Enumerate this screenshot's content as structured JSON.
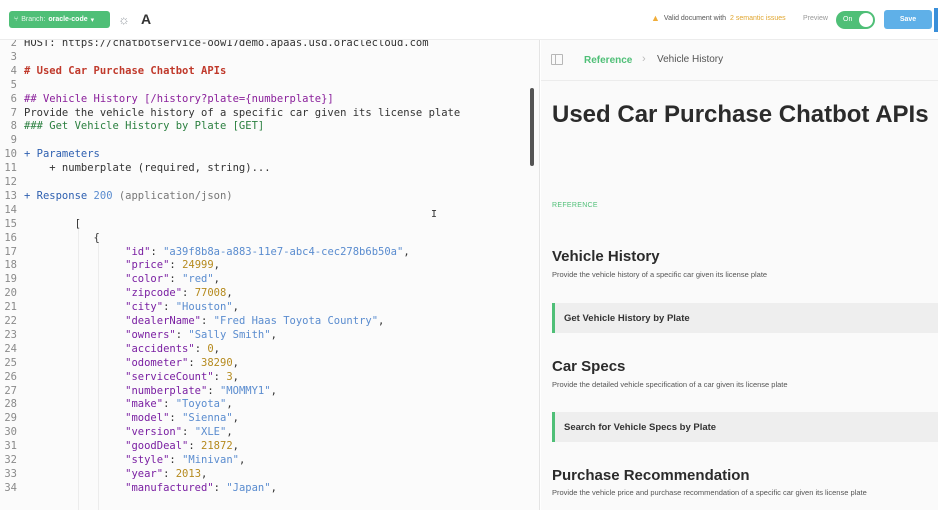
{
  "toolbar": {
    "branch_label": "Branch:",
    "branch_value": "oracle-code",
    "font_icon_label": "A",
    "validity_text": "Valid document with",
    "validity_issues": "2 semantic issues",
    "preview_label": "Preview",
    "toggle_label": "On",
    "save_label": "Save"
  },
  "editor": {
    "lines": [
      {
        "n": "2",
        "tokens": [
          {
            "t": "HOST: https://chatbotservice-oow17demo.apaas.usd.oraclecloud.com",
            "c": "t-plain"
          }
        ]
      },
      {
        "n": "3",
        "tokens": []
      },
      {
        "n": "4",
        "tokens": [
          {
            "t": "# Used Car Purchase Chatbot APIs",
            "c": "t-h"
          }
        ]
      },
      {
        "n": "5",
        "tokens": []
      },
      {
        "n": "6",
        "tokens": [
          {
            "t": "## Vehicle History [/history?plate={numberplate}]",
            "c": "t-h2"
          }
        ]
      },
      {
        "n": "7",
        "tokens": [
          {
            "t": "Provide the vehicle history of a specific car given its license plate",
            "c": "t-plain"
          }
        ]
      },
      {
        "n": "8",
        "tokens": [
          {
            "t": "### Get Vehicle History by Plate [GET]",
            "c": "t-green"
          }
        ]
      },
      {
        "n": "9",
        "tokens": []
      },
      {
        "n": "10",
        "tokens": [
          {
            "t": "+ Parameters",
            "c": "t-blue"
          }
        ]
      },
      {
        "n": "11",
        "tokens": [
          {
            "t": "    + numberplate (required, string)...",
            "c": "t-plain"
          }
        ]
      },
      {
        "n": "12",
        "tokens": []
      },
      {
        "n": "13",
        "tokens": [
          {
            "t": "+ Response ",
            "c": "t-blue"
          },
          {
            "t": "200",
            "c": "t-str"
          },
          {
            "t": " (application/json)",
            "c": "t-gray"
          }
        ]
      },
      {
        "n": "14",
        "tokens": []
      },
      {
        "n": "15",
        "tokens": [
          {
            "t": "        [",
            "c": "t-punc"
          }
        ]
      },
      {
        "n": "16",
        "tokens": [
          {
            "t": "           {",
            "c": "t-punc"
          }
        ]
      },
      {
        "n": "17",
        "tokens": [
          {
            "t": "                \"id\"",
            "c": "t-key"
          },
          {
            "t": ": ",
            "c": "t-punc"
          },
          {
            "t": "\"a39f8b8a-a883-11e7-abc4-cec278b6b50a\"",
            "c": "t-str"
          },
          {
            "t": ",",
            "c": "t-punc"
          }
        ]
      },
      {
        "n": "18",
        "tokens": [
          {
            "t": "                \"price\"",
            "c": "t-key"
          },
          {
            "t": ": ",
            "c": "t-punc"
          },
          {
            "t": "24999",
            "c": "t-num"
          },
          {
            "t": ",",
            "c": "t-punc"
          }
        ]
      },
      {
        "n": "19",
        "tokens": [
          {
            "t": "                \"color\"",
            "c": "t-key"
          },
          {
            "t": ": ",
            "c": "t-punc"
          },
          {
            "t": "\"red\"",
            "c": "t-str"
          },
          {
            "t": ",",
            "c": "t-punc"
          }
        ]
      },
      {
        "n": "20",
        "tokens": [
          {
            "t": "                \"zipcode\"",
            "c": "t-key"
          },
          {
            "t": ": ",
            "c": "t-punc"
          },
          {
            "t": "77008",
            "c": "t-num"
          },
          {
            "t": ",",
            "c": "t-punc"
          }
        ]
      },
      {
        "n": "21",
        "tokens": [
          {
            "t": "                \"city\"",
            "c": "t-key"
          },
          {
            "t": ": ",
            "c": "t-punc"
          },
          {
            "t": "\"Houston\"",
            "c": "t-str"
          },
          {
            "t": ",",
            "c": "t-punc"
          }
        ]
      },
      {
        "n": "22",
        "tokens": [
          {
            "t": "                \"dealerName\"",
            "c": "t-key"
          },
          {
            "t": ": ",
            "c": "t-punc"
          },
          {
            "t": "\"Fred Haas Toyota Country\"",
            "c": "t-str"
          },
          {
            "t": ",",
            "c": "t-punc"
          }
        ]
      },
      {
        "n": "23",
        "tokens": [
          {
            "t": "                \"owners\"",
            "c": "t-key"
          },
          {
            "t": ": ",
            "c": "t-punc"
          },
          {
            "t": "\"Sally Smith\"",
            "c": "t-str"
          },
          {
            "t": ",",
            "c": "t-punc"
          }
        ]
      },
      {
        "n": "24",
        "tokens": [
          {
            "t": "                \"accidents\"",
            "c": "t-key"
          },
          {
            "t": ": ",
            "c": "t-punc"
          },
          {
            "t": "0",
            "c": "t-num"
          },
          {
            "t": ",",
            "c": "t-punc"
          }
        ]
      },
      {
        "n": "25",
        "tokens": [
          {
            "t": "                \"odometer\"",
            "c": "t-key"
          },
          {
            "t": ": ",
            "c": "t-punc"
          },
          {
            "t": "38290",
            "c": "t-num"
          },
          {
            "t": ",",
            "c": "t-punc"
          }
        ]
      },
      {
        "n": "26",
        "tokens": [
          {
            "t": "                \"serviceCount\"",
            "c": "t-key"
          },
          {
            "t": ": ",
            "c": "t-punc"
          },
          {
            "t": "3",
            "c": "t-num"
          },
          {
            "t": ",",
            "c": "t-punc"
          }
        ]
      },
      {
        "n": "27",
        "tokens": [
          {
            "t": "                \"numberplate\"",
            "c": "t-key"
          },
          {
            "t": ": ",
            "c": "t-punc"
          },
          {
            "t": "\"MOMMY1\"",
            "c": "t-str"
          },
          {
            "t": ",",
            "c": "t-punc"
          }
        ]
      },
      {
        "n": "28",
        "tokens": [
          {
            "t": "                \"make\"",
            "c": "t-key"
          },
          {
            "t": ": ",
            "c": "t-punc"
          },
          {
            "t": "\"Toyota\"",
            "c": "t-str"
          },
          {
            "t": ",",
            "c": "t-punc"
          }
        ]
      },
      {
        "n": "29",
        "tokens": [
          {
            "t": "                \"model\"",
            "c": "t-key"
          },
          {
            "t": ": ",
            "c": "t-punc"
          },
          {
            "t": "\"Sienna\"",
            "c": "t-str"
          },
          {
            "t": ",",
            "c": "t-punc"
          }
        ]
      },
      {
        "n": "30",
        "tokens": [
          {
            "t": "                \"version\"",
            "c": "t-key"
          },
          {
            "t": ": ",
            "c": "t-punc"
          },
          {
            "t": "\"XLE\"",
            "c": "t-str"
          },
          {
            "t": ",",
            "c": "t-punc"
          }
        ]
      },
      {
        "n": "31",
        "tokens": [
          {
            "t": "                \"goodDeal\"",
            "c": "t-key"
          },
          {
            "t": ": ",
            "c": "t-punc"
          },
          {
            "t": "21872",
            "c": "t-num"
          },
          {
            "t": ",",
            "c": "t-punc"
          }
        ]
      },
      {
        "n": "32",
        "tokens": [
          {
            "t": "                \"style\"",
            "c": "t-key"
          },
          {
            "t": ": ",
            "c": "t-punc"
          },
          {
            "t": "\"Minivan\"",
            "c": "t-str"
          },
          {
            "t": ",",
            "c": "t-punc"
          }
        ]
      },
      {
        "n": "33",
        "tokens": [
          {
            "t": "                \"year\"",
            "c": "t-key"
          },
          {
            "t": ": ",
            "c": "t-punc"
          },
          {
            "t": "2013",
            "c": "t-num"
          },
          {
            "t": ",",
            "c": "t-punc"
          }
        ]
      },
      {
        "n": "34",
        "tokens": [
          {
            "t": "                \"manufactured\"",
            "c": "t-key"
          },
          {
            "t": ": ",
            "c": "t-punc"
          },
          {
            "t": "\"Japan\"",
            "c": "t-str"
          },
          {
            "t": ",",
            "c": "t-punc"
          }
        ]
      }
    ]
  },
  "docs": {
    "breadcrumb_root": "Reference",
    "breadcrumb_current": "Vehicle History",
    "title": "Used Car Purchase Chatbot APIs",
    "reference_label": "REFERENCE",
    "sections": [
      {
        "title": "Vehicle History",
        "desc": "Provide the vehicle history of a specific car given its license plate",
        "endpoint": "Get Vehicle History by Plate"
      },
      {
        "title": "Car Specs",
        "desc": "Provide the detailed vehicle specification of a car given its license plate",
        "endpoint": "Search for Vehicle Specs by Plate"
      },
      {
        "title": "Purchase Recommendation",
        "desc": "Provide the vehicle price and purchase recommendation of a specific car given its license plate",
        "endpoint": ""
      }
    ]
  }
}
